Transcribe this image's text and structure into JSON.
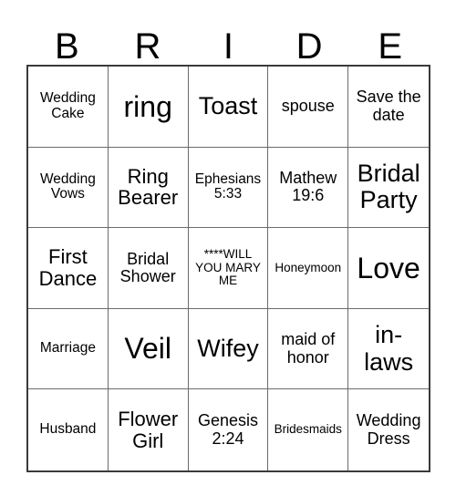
{
  "card": {
    "header_letters": [
      "B",
      "R",
      "I",
      "D",
      "E"
    ],
    "columns": 5,
    "rows": 5,
    "cells": [
      {
        "text": "Wedding Cake",
        "size": "fs-sm"
      },
      {
        "text": "ring",
        "size": "fs-xxl"
      },
      {
        "text": "Toast",
        "size": "fs-xl"
      },
      {
        "text": "spouse",
        "size": "fs-md"
      },
      {
        "text": "Save the date",
        "size": "fs-md"
      },
      {
        "text": "Wedding Vows",
        "size": "fs-sm"
      },
      {
        "text": "Ring Bearer",
        "size": "fs-lg"
      },
      {
        "text": "Ephesians 5:33",
        "size": "fs-sm"
      },
      {
        "text": "Mathew 19:6",
        "size": "fs-md"
      },
      {
        "text": "Bridal Party",
        "size": "fs-xl"
      },
      {
        "text": "First Dance",
        "size": "fs-lg"
      },
      {
        "text": "Bridal Shower",
        "size": "fs-md"
      },
      {
        "text": "****WILL YOU MARY ME",
        "size": "fs-xs"
      },
      {
        "text": "Honeymoon",
        "size": "fs-xs"
      },
      {
        "text": "Love",
        "size": "fs-xxl"
      },
      {
        "text": "Marriage",
        "size": "fs-sm"
      },
      {
        "text": "Veil",
        "size": "fs-xxl"
      },
      {
        "text": "Wifey",
        "size": "fs-xl"
      },
      {
        "text": "maid of honor",
        "size": "fs-md"
      },
      {
        "text": "in-laws",
        "size": "fs-xl"
      },
      {
        "text": "Husband",
        "size": "fs-sm"
      },
      {
        "text": "Flower Girl",
        "size": "fs-lg"
      },
      {
        "text": "Genesis 2:24",
        "size": "fs-md"
      },
      {
        "text": "Bridesmaids",
        "size": "fs-xs"
      },
      {
        "text": "Wedding Dress",
        "size": "fs-md"
      }
    ]
  },
  "colors": {
    "page_background": "#ffffff",
    "text": "#000000",
    "outer_border": "#3a3a3a",
    "inner_border": "#6b6b6b"
  }
}
